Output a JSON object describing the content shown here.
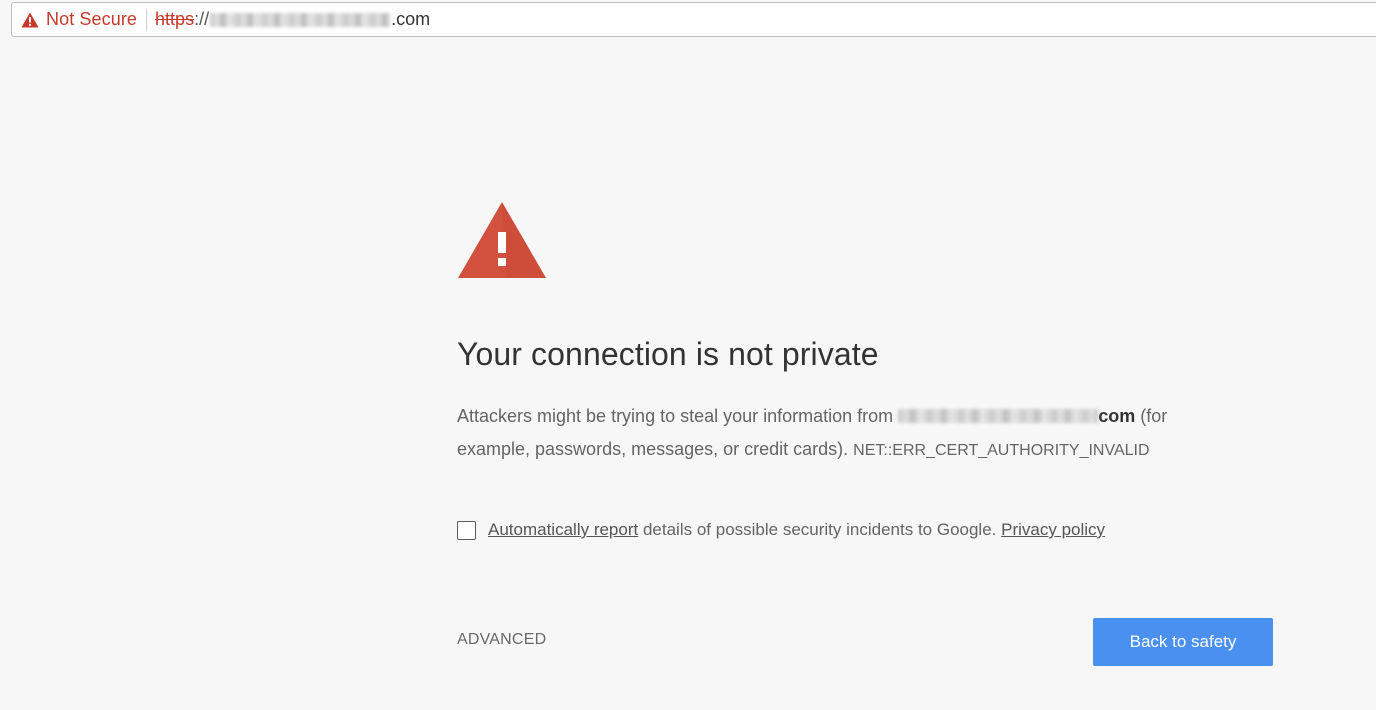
{
  "address_bar": {
    "security_label": "Not Secure",
    "url_scheme": "https",
    "url_separator": "://",
    "url_tld": ".com"
  },
  "icons": {
    "address_warning": "warning-triangle-icon",
    "page_warning": "warning-triangle-icon"
  },
  "main": {
    "heading": "Your connection is not private",
    "message": {
      "prefix": "Attackers might be trying to steal your information from",
      "host_tld": "com",
      "suffix_line1": "(for",
      "suffix_line2": "example, passwords, messages, or credit cards).",
      "error_code": "NET::ERR_CERT_AUTHORITY_INVALID"
    },
    "report": {
      "checked": false,
      "link_label": "Automatically report",
      "text": "details of possible security incidents to Google.",
      "privacy_label": "Privacy policy"
    },
    "advanced_label": "ADVANCED",
    "primary_label": "Back to safety"
  },
  "colors": {
    "danger": "#c5392a",
    "warning_icon": "#d1503e",
    "primary_button": "#4a90f0",
    "background": "#f7f7f7"
  }
}
